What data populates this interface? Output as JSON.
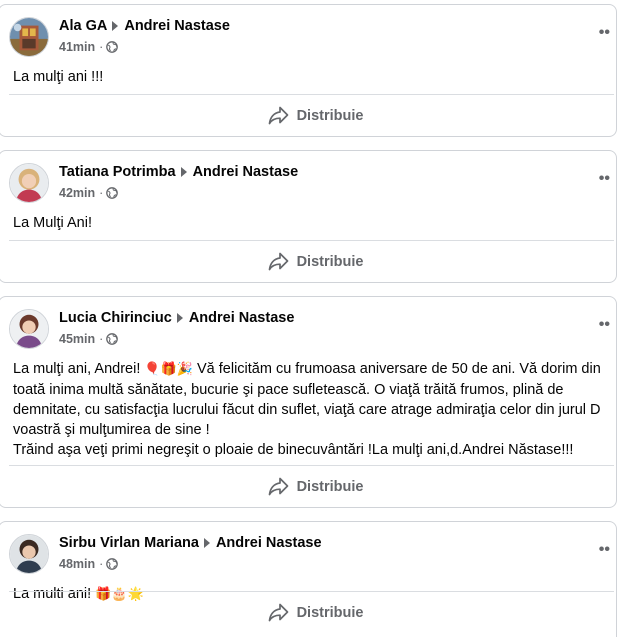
{
  "posts": [
    {
      "author": "Ala GA",
      "target": "Andrei Nastase",
      "time": "41min",
      "separator": "·",
      "body_lines": [
        "La mulţi ani !!!"
      ],
      "share_label": "Distribuie"
    },
    {
      "author": "Tatiana Potrimba",
      "target": "Andrei Nastase",
      "time": "42min",
      "separator": "·",
      "body_lines": [
        "La Mulţi Ani!"
      ],
      "share_label": "Distribuie"
    },
    {
      "author": "Lucia Chirinciuc",
      "target": "Andrei Nastase",
      "time": "45min",
      "separator": "·",
      "body_line1_prefix": "La mulţi ani, Andrei!",
      "body_line1_emojis": [
        "🎈",
        "🎁",
        "🎉"
      ],
      "body_line1_suffix": "Vă felicităm cu frumoasa aniversare de 50 de ani. Vă dorim din",
      "body_lines": [
        "toată inima multă sănătate, bucurie şi pace sufletească. O viaţă trăită frumos, plină de",
        "demnitate, cu satisfacţia lucrului făcut din suflet, viaţă care atrage admiraţia celor din jurul D",
        "voastră şi mulţumirea de sine !",
        "Trăind aşa veţi primi negreşit o ploaie de binecuvântări !La mulţi ani,d.Andrei Năstase!!!"
      ],
      "share_label": "Distribuie"
    },
    {
      "author": "Sirbu Virlan Mariana",
      "target": "Andrei Nastase",
      "time": "48min",
      "separator": "·",
      "body_line1_prefix": "La multi ani!",
      "body_line1_emojis": [
        "🎁",
        "🎂",
        "🌟"
      ],
      "share_label": "Distribuie"
    }
  ],
  "icons": {
    "more": "more-options-icon",
    "globe": "globe-icon",
    "share": "share-icon",
    "arrow": "arrow-right-icon"
  },
  "colors": {
    "secondary_text": "#65676b",
    "border": "#d0d3d8",
    "text": "#050505"
  }
}
